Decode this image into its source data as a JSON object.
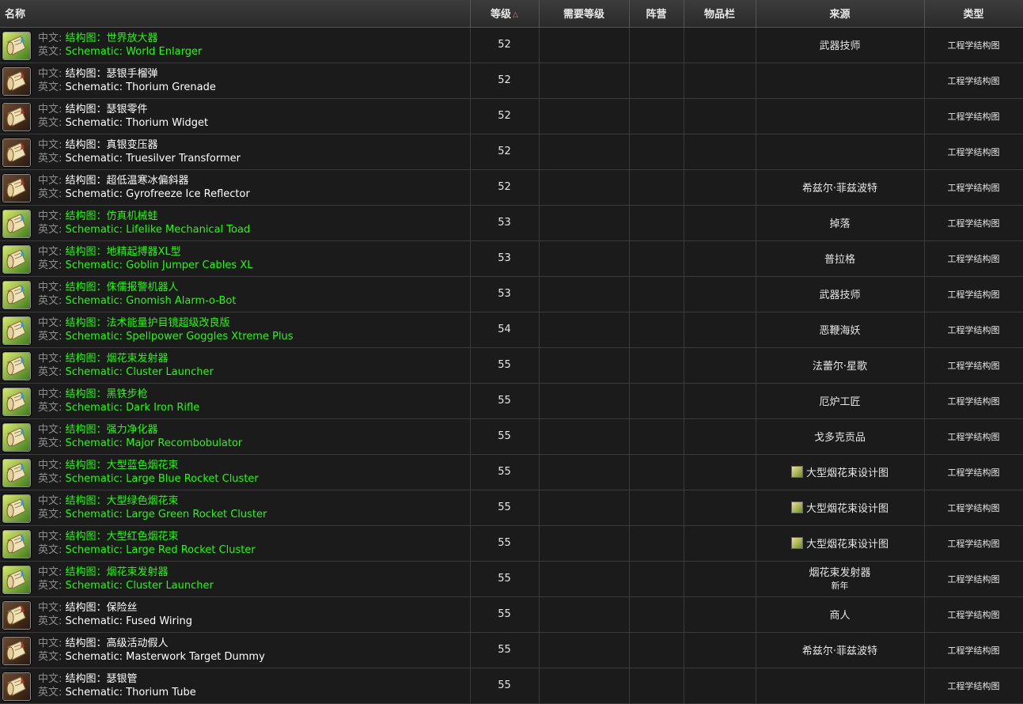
{
  "columns": {
    "name": "名称",
    "level": "等级",
    "req_level": "需要等级",
    "faction": "阵营",
    "slot": "物品栏",
    "source": "来源",
    "type": "类型"
  },
  "labels": {
    "cn_prefix": "中文:",
    "en_prefix": "英文:"
  },
  "colors": {
    "uncommon_green": "#1eff00",
    "common_white": "#ffffff",
    "sort_arrow": "#ff7070"
  },
  "rows": [
    {
      "cn": "结构图：世界放大器",
      "en": "Schematic: World Enlarger",
      "level": "52",
      "source": "武器技师",
      "source_sub": "",
      "source_icon": false,
      "type": "工程学结构图",
      "quality": "uncommon",
      "icon": "scroll-green-icon"
    },
    {
      "cn": "结构图：瑟银手榴弹",
      "en": "Schematic: Thorium Grenade",
      "level": "52",
      "source": "",
      "source_sub": "",
      "source_icon": false,
      "type": "工程学结构图",
      "quality": "common",
      "icon": "scroll-red-icon"
    },
    {
      "cn": "结构图：瑟银零件",
      "en": "Schematic: Thorium Widget",
      "level": "52",
      "source": "",
      "source_sub": "",
      "source_icon": false,
      "type": "工程学结构图",
      "quality": "common",
      "icon": "scroll-red-icon"
    },
    {
      "cn": "结构图：真银变压器",
      "en": "Schematic: Truesilver Transformer",
      "level": "52",
      "source": "",
      "source_sub": "",
      "source_icon": false,
      "type": "工程学结构图",
      "quality": "common",
      "icon": "scroll-red-icon"
    },
    {
      "cn": "结构图：超低温寒冰偏斜器",
      "en": "Schematic: Gyrofreeze Ice Reflector",
      "level": "52",
      "source": "希兹尔·菲兹波特",
      "source_sub": "",
      "source_icon": false,
      "type": "工程学结构图",
      "quality": "common",
      "icon": "scroll-red-icon"
    },
    {
      "cn": "结构图：仿真机械蛙",
      "en": "Schematic: Lifelike Mechanical Toad",
      "level": "53",
      "source": "掉落",
      "source_sub": "",
      "source_icon": false,
      "type": "工程学结构图",
      "quality": "uncommon",
      "icon": "scroll-green-icon"
    },
    {
      "cn": "结构图：地精起搏器XL型",
      "en": "Schematic: Goblin Jumper Cables XL",
      "level": "53",
      "source": "普拉格",
      "source_sub": "",
      "source_icon": false,
      "type": "工程学结构图",
      "quality": "uncommon",
      "icon": "scroll-green-icon"
    },
    {
      "cn": "结构图：侏儒报警机器人",
      "en": "Schematic: Gnomish Alarm-o-Bot",
      "level": "53",
      "source": "武器技师",
      "source_sub": "",
      "source_icon": false,
      "type": "工程学结构图",
      "quality": "uncommon",
      "icon": "scroll-green-icon"
    },
    {
      "cn": "结构图：法术能量护目镜超级改良版",
      "en": "Schematic: Spellpower Goggles Xtreme Plus",
      "level": "54",
      "source": "恶鞭海妖",
      "source_sub": "",
      "source_icon": false,
      "type": "工程学结构图",
      "quality": "uncommon",
      "icon": "scroll-green-icon"
    },
    {
      "cn": "结构图：烟花束发射器",
      "en": "Schematic: Cluster Launcher",
      "level": "55",
      "source": "法蕾尔·星歌",
      "source_sub": "",
      "source_icon": false,
      "type": "工程学结构图",
      "quality": "uncommon",
      "icon": "scroll-green-icon"
    },
    {
      "cn": "结构图：黑铁步枪",
      "en": "Schematic: Dark Iron Rifle",
      "level": "55",
      "source": "厄炉工匠",
      "source_sub": "",
      "source_icon": false,
      "type": "工程学结构图",
      "quality": "uncommon",
      "icon": "scroll-green-icon"
    },
    {
      "cn": "结构图：强力净化器",
      "en": "Schematic: Major Recombobulator",
      "level": "55",
      "source": "戈多克贡品",
      "source_sub": "",
      "source_icon": false,
      "type": "工程学结构图",
      "quality": "uncommon",
      "icon": "scroll-green-icon"
    },
    {
      "cn": "结构图：大型蓝色烟花束",
      "en": "Schematic: Large Blue Rocket Cluster",
      "level": "55",
      "source": "大型烟花束设计图",
      "source_sub": "",
      "source_icon": true,
      "type": "工程学结构图",
      "quality": "uncommon",
      "icon": "scroll-green-icon"
    },
    {
      "cn": "结构图：大型绿色烟花束",
      "en": "Schematic: Large Green Rocket Cluster",
      "level": "55",
      "source": "大型烟花束设计图",
      "source_sub": "",
      "source_icon": true,
      "type": "工程学结构图",
      "quality": "uncommon",
      "icon": "scroll-green-icon"
    },
    {
      "cn": "结构图：大型红色烟花束",
      "en": "Schematic: Large Red Rocket Cluster",
      "level": "55",
      "source": "大型烟花束设计图",
      "source_sub": "",
      "source_icon": true,
      "type": "工程学结构图",
      "quality": "uncommon",
      "icon": "scroll-green-icon"
    },
    {
      "cn": "结构图：烟花束发射器",
      "en": "Schematic: Cluster Launcher",
      "level": "55",
      "source": "烟花束发射器",
      "source_sub": "新年",
      "source_icon": false,
      "type": "工程学结构图",
      "quality": "uncommon",
      "icon": "scroll-green-icon"
    },
    {
      "cn": "结构图：保险丝",
      "en": "Schematic: Fused Wiring",
      "level": "55",
      "source": "商人",
      "source_sub": "",
      "source_icon": false,
      "type": "工程学结构图",
      "quality": "common",
      "icon": "scroll-red-icon"
    },
    {
      "cn": "结构图：高级活动假人",
      "en": "Schematic: Masterwork Target Dummy",
      "level": "55",
      "source": "希兹尔·菲兹波特",
      "source_sub": "",
      "source_icon": false,
      "type": "工程学结构图",
      "quality": "common",
      "icon": "scroll-red-icon"
    },
    {
      "cn": "结构图：瑟银管",
      "en": "Schematic: Thorium Tube",
      "level": "55",
      "source": "",
      "source_sub": "",
      "source_icon": false,
      "type": "工程学结构图",
      "quality": "common",
      "icon": "scroll-red-icon"
    }
  ]
}
